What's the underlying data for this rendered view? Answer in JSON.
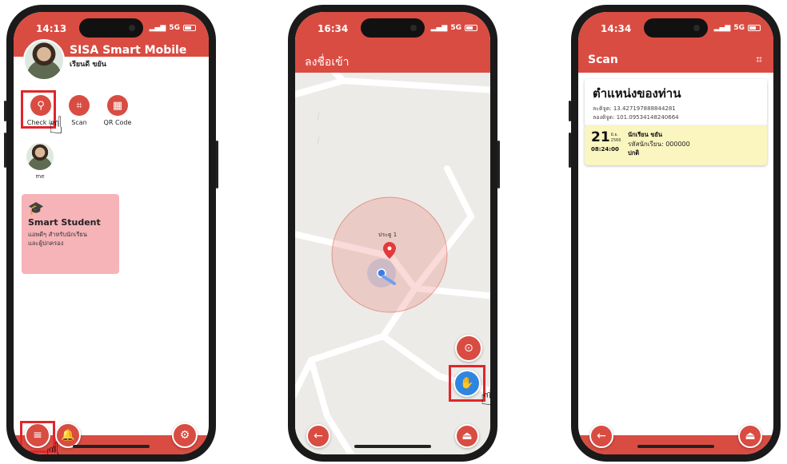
{
  "phone1": {
    "time": "14:13",
    "network": "5G",
    "app_title": "SISA Smart Mobile",
    "username": "เรียนดี ขยัน",
    "menu": [
      {
        "label": "Check in",
        "icon": "location-pin-icon"
      },
      {
        "label": "Scan",
        "icon": "scan-icon"
      },
      {
        "label": "QR Code",
        "icon": "qr-code-icon"
      }
    ],
    "profile_label": "me",
    "card": {
      "title": "Smart Student",
      "desc_line1": "แอพดีๆ สำหรับนักเรียน",
      "desc_line2": "และผู้ปกครอง",
      "icon": "graduation-cap-icon"
    },
    "bottom": {
      "menu_icon": "hamburger-icon",
      "bell_icon": "bell-icon",
      "settings_icon": "gear-icon"
    }
  },
  "phone2": {
    "time": "16:34",
    "network": "5G",
    "page_title": "ลงชื่อเข้า",
    "map_label": "ประตู 1",
    "buttons": {
      "locate_icon": "locate-icon",
      "checkin_icon": "fingerprint-icon",
      "back_icon": "back-arrow-icon",
      "eject_icon": "eject-icon"
    }
  },
  "phone3": {
    "time": "14:34",
    "network": "5G",
    "page_title": "Scan",
    "scan_icon": "scan-frame-icon",
    "location_title": "ตำแหน่งของท่าน",
    "latitude": "ละติจูด: 13.427197888844281",
    "longitude": "ลองติจูด: 101.09534148240664",
    "record": {
      "day": "21",
      "month": "มิ.ย.",
      "year": "2566",
      "time": "08:24:00",
      "name": "นักเรียน ขยัน",
      "student_id": "รหัสนักเรียน: 000000",
      "status": "ปกติ"
    },
    "buttons": {
      "back_icon": "back-arrow-icon",
      "eject_icon": "eject-icon"
    }
  },
  "colors": {
    "primary": "#d94c42",
    "card": "#f6b3b8",
    "record": "#fbf5c0",
    "highlight": "#e0262b",
    "blue_button": "#2f86e0"
  }
}
